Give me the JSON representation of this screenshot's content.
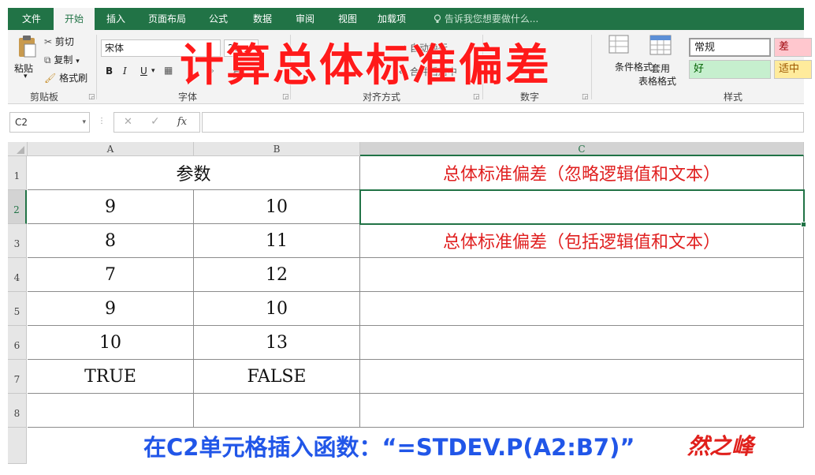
{
  "ribbon_tabs": [
    {
      "label": "文件"
    },
    {
      "label": "开始"
    },
    {
      "label": "插入"
    },
    {
      "label": "页面布局"
    },
    {
      "label": "公式"
    },
    {
      "label": "数据"
    },
    {
      "label": "审阅"
    },
    {
      "label": "视图"
    },
    {
      "label": "加载项"
    }
  ],
  "tell_me": "告诉我您想要做什么...",
  "clipboard": {
    "paste": "粘贴",
    "cut": "剪切",
    "copy": "复制",
    "format_painter": "格式刷",
    "group": "剪贴板"
  },
  "font": {
    "name": "宋体",
    "size": "20",
    "bold": "B",
    "italic": "I",
    "underline": "U",
    "group": "字体"
  },
  "alignment": {
    "wrap": "自动换行",
    "merge": "合并后居中",
    "group": "对齐方式"
  },
  "number": {
    "group": "数字"
  },
  "styles": {
    "conditional": "条件格式",
    "table_format_1": "套用",
    "table_format_2": "表格格式",
    "normal": "常规",
    "bad": "差",
    "good": "好",
    "neutral": "适中",
    "group": "样式"
  },
  "formula_bar": {
    "name_box": "C2",
    "cancel": "✕",
    "enter": "✓",
    "fx": "fx",
    "value": ""
  },
  "sheet": {
    "columns": [
      "A",
      "B",
      "C"
    ],
    "rows": [
      "1",
      "2",
      "3",
      "4",
      "5",
      "6",
      "7",
      "8"
    ],
    "header_merged": "参数",
    "a": [
      "9",
      "8",
      "7",
      "9",
      "10",
      "TRUE"
    ],
    "b": [
      "10",
      "11",
      "12",
      "10",
      "13",
      "FALSE"
    ],
    "c1": "总体标准偏差（忽略逻辑值和文本）",
    "c3": "总体标准偏差（包括逻辑值和文本）"
  },
  "overlay": {
    "title": "计算总体标准偏差",
    "caption": "在C2单元格插入函数：“=STDEV.P(A2:B7)”",
    "signature": "然之峰"
  },
  "colors": {
    "excel_green": "#217346",
    "title_red": "#ff1a1a",
    "caption_blue": "#2156e8",
    "bad_fill": "#ffc7ce",
    "good_fill": "#c6efce",
    "neutral_fill": "#ffeb9c"
  }
}
